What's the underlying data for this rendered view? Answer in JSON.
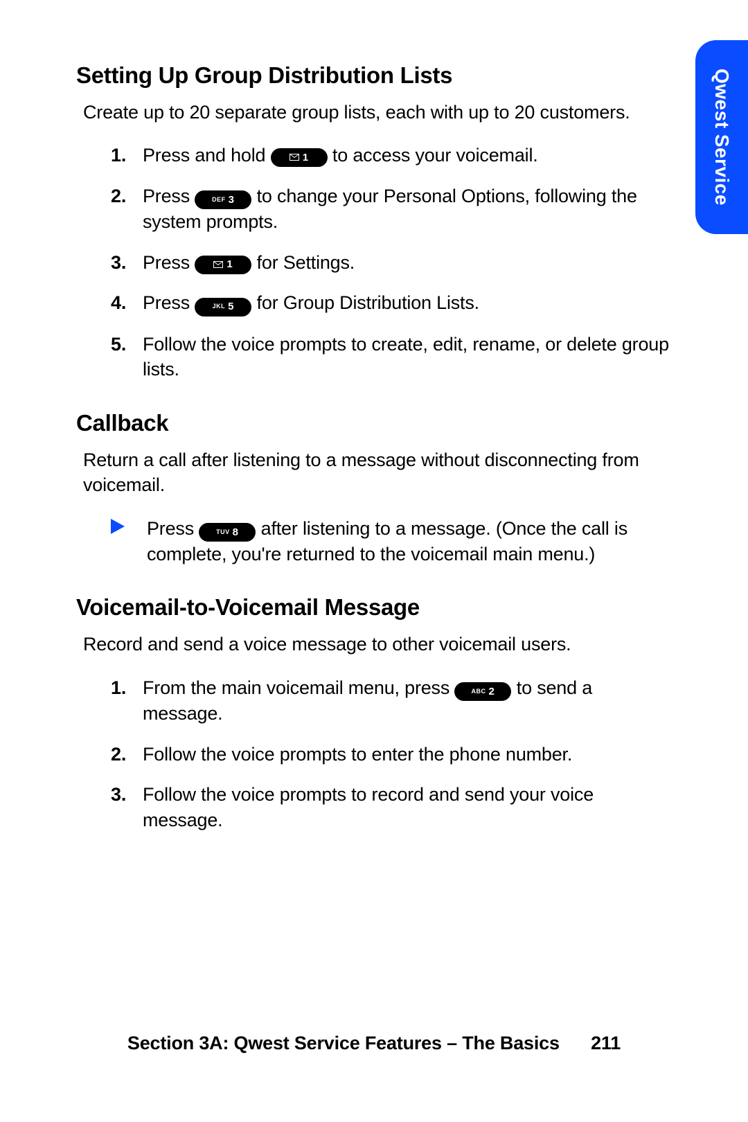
{
  "side_tab": "Qwest Service",
  "sec1": {
    "title": "Setting Up Group Distribution Lists",
    "intro": "Create up to 20 separate group lists, each with up to 20 customers.",
    "steps": [
      {
        "num": "1.",
        "pre": "Press and hold ",
        "key_sub": "ENV",
        "key_main": "1",
        "post": " to access your voicemail."
      },
      {
        "num": "2.",
        "pre": "Press ",
        "key_sub": "DEF",
        "key_main": "3",
        "post": " to change your Personal Options, following the system prompts."
      },
      {
        "num": "3.",
        "pre": "Press ",
        "key_sub": "ENV",
        "key_main": "1",
        "post": " for Settings."
      },
      {
        "num": "4.",
        "pre": "Press ",
        "key_sub": "JKL",
        "key_main": "5",
        "post": " for Group Distribution Lists."
      },
      {
        "num": "5.",
        "text": "Follow the voice prompts to create, edit, rename, or delete group lists."
      }
    ]
  },
  "sec2": {
    "title": "Callback",
    "intro": "Return a call after listening to a message without disconnecting from voicemail.",
    "bullet": {
      "pre": "Press ",
      "key_sub": "TUV",
      "key_main": "8",
      "post": " after listening to a message. (Once the call is complete, you're returned to the voicemail main menu.)"
    }
  },
  "sec3": {
    "title": "Voicemail-to-Voicemail Message",
    "intro": "Record and send a voice message to other voicemail users.",
    "steps": [
      {
        "num": "1.",
        "pre": "From the main voicemail menu, press ",
        "key_sub": "ABC",
        "key_main": "2",
        "post": " to send a message."
      },
      {
        "num": "2.",
        "text": "Follow the voice prompts to enter the phone number."
      },
      {
        "num": "3.",
        "text": "Follow the voice prompts to record and send your voice message."
      }
    ]
  },
  "footer": {
    "section": "Section 3A: Qwest Service Features – The Basics",
    "page": "211"
  }
}
